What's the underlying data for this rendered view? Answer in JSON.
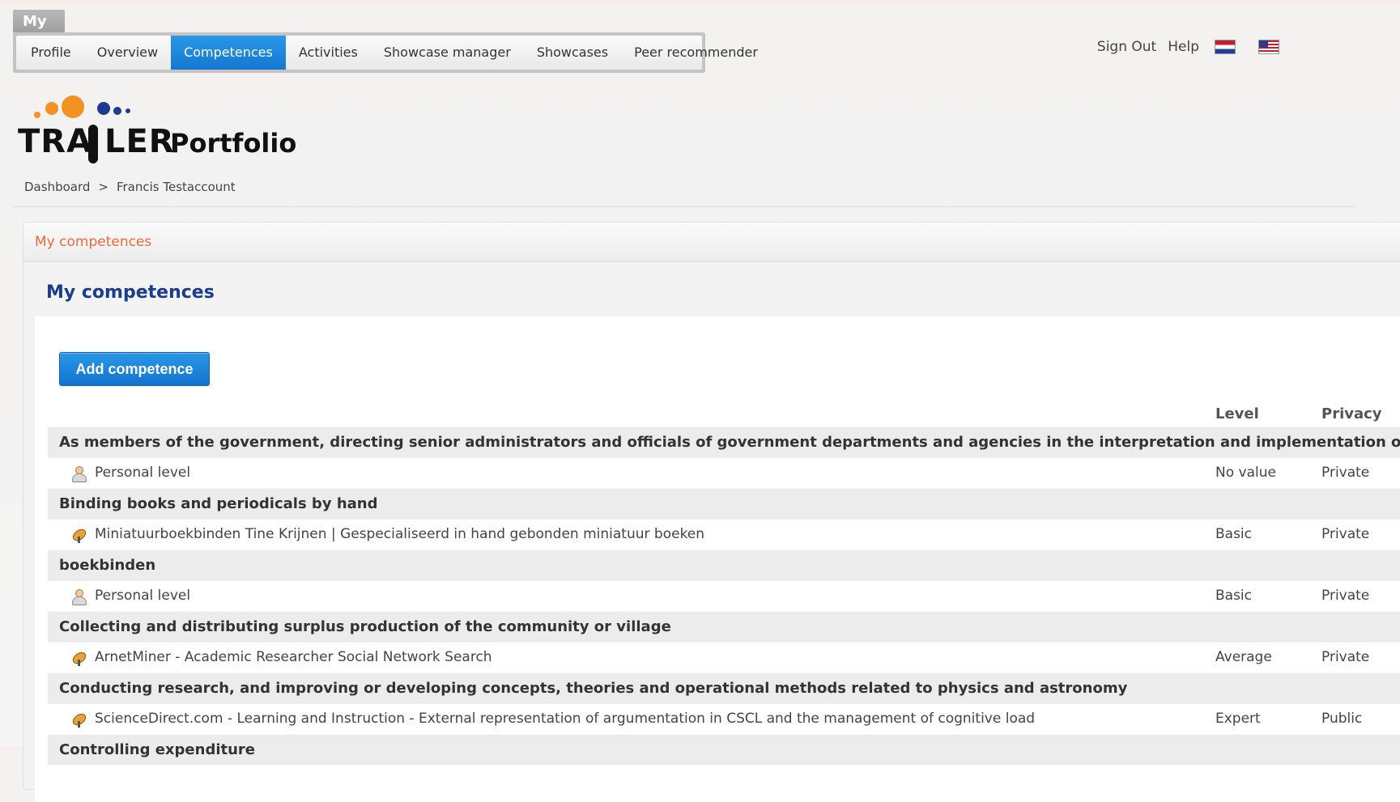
{
  "nav": {
    "my_tab": "My",
    "items": [
      {
        "label": "Profile"
      },
      {
        "label": "Overview"
      },
      {
        "label": "Competences",
        "active": true
      },
      {
        "label": "Activities"
      },
      {
        "label": "Showcase manager"
      },
      {
        "label": "Showcases"
      },
      {
        "label": "Peer recommender"
      }
    ]
  },
  "top_links": {
    "sign_out": "Sign Out",
    "help": "Help",
    "flags": [
      "dutch-flag-icon",
      "us-flag-icon"
    ]
  },
  "logo": {
    "word": "TRA LER",
    "subtitle": "Portfolio",
    "dot_colors": [
      "#f39222",
      "#1f3b8f"
    ]
  },
  "breadcrumb": {
    "items": [
      "Dashboard",
      ">",
      "Francis Testaccount"
    ]
  },
  "panel": {
    "header": "My competences",
    "title": "My competences",
    "add_button": "Add competence"
  },
  "table": {
    "columns": {
      "level": "Level",
      "privacy": "Privacy"
    },
    "groups": [
      {
        "title": "As members of the government, directing senior administrators and officials of government departments and agencies in the interpretation and implementation of government policies",
        "item": {
          "icon": "person-icon",
          "label": "Personal level",
          "level": "No value",
          "privacy": "Private"
        }
      },
      {
        "title": "Binding books and periodicals by hand",
        "item": {
          "icon": "satellite-icon",
          "label": "Miniatuurboekbinden Tine Krijnen | Gespecialiseerd in hand gebonden miniatuur boeken",
          "level": "Basic",
          "privacy": "Private"
        }
      },
      {
        "title": "boekbinden",
        "item": {
          "icon": "person-icon",
          "label": "Personal level",
          "level": "Basic",
          "privacy": "Private"
        }
      },
      {
        "title": "Collecting and distributing surplus production of the community or village",
        "item": {
          "icon": "satellite-icon",
          "label": "ArnetMiner - Academic Researcher Social Network Search",
          "level": "Average",
          "privacy": "Private"
        }
      },
      {
        "title": "Conducting research, and improving or developing concepts, theories and operational methods related to physics and astronomy",
        "item": {
          "icon": "satellite-icon",
          "label": "ScienceDirect.com - Learning and Instruction - External representation of argumentation in CSCL and the management of cognitive load",
          "level": "Expert",
          "privacy": "Public"
        }
      },
      {
        "title": "Controlling expenditure"
      }
    ]
  },
  "colors": {
    "accent_blue": "#1478d0",
    "header_orange": "#e96a3a",
    "title_blue": "#1a3d8f"
  }
}
